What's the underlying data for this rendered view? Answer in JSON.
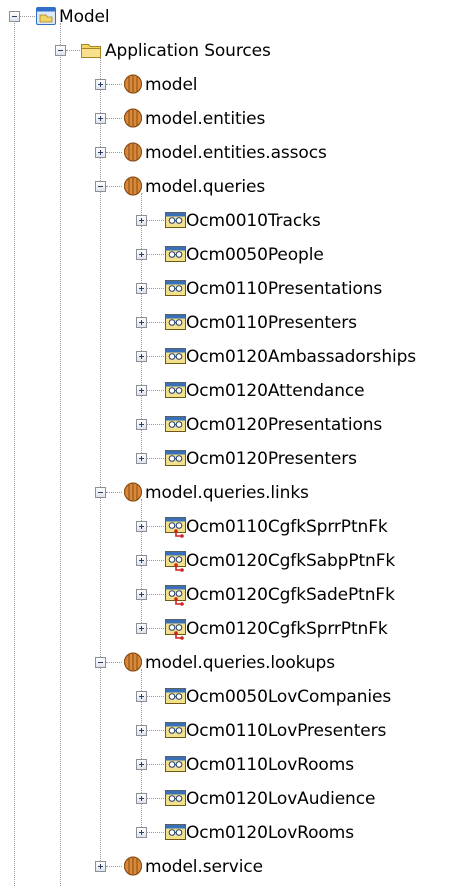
{
  "tree": {
    "root": {
      "label": "Model",
      "icon": "model-project-icon",
      "expanded": true
    },
    "nodes": [
      {
        "label": "Application Sources",
        "icon": "folder-icon",
        "level": 1,
        "expanded": true
      },
      {
        "label": "model",
        "icon": "package-icon",
        "level": 2,
        "expanded": false
      },
      {
        "label": "model.entities",
        "icon": "package-icon",
        "level": 2,
        "expanded": false
      },
      {
        "label": "model.entities.assocs",
        "icon": "package-icon",
        "level": 2,
        "expanded": false
      },
      {
        "label": "model.queries",
        "icon": "package-icon",
        "level": 2,
        "expanded": true
      },
      {
        "label": "Ocm0010Tracks",
        "icon": "view-object-icon",
        "level": 3,
        "expanded": false
      },
      {
        "label": "Ocm0050People",
        "icon": "view-object-icon",
        "level": 3,
        "expanded": false
      },
      {
        "label": "Ocm0110Presentations",
        "icon": "view-object-icon",
        "level": 3,
        "expanded": false
      },
      {
        "label": "Ocm0110Presenters",
        "icon": "view-object-icon",
        "level": 3,
        "expanded": false
      },
      {
        "label": "Ocm0120Ambassadorships",
        "icon": "view-object-icon",
        "level": 3,
        "expanded": false
      },
      {
        "label": "Ocm0120Attendance",
        "icon": "view-object-icon",
        "level": 3,
        "expanded": false
      },
      {
        "label": "Ocm0120Presentations",
        "icon": "view-object-icon",
        "level": 3,
        "expanded": false
      },
      {
        "label": "Ocm0120Presenters",
        "icon": "view-object-icon",
        "level": 3,
        "expanded": false
      },
      {
        "label": "model.queries.links",
        "icon": "package-icon",
        "level": 2,
        "expanded": true
      },
      {
        "label": "Ocm0110CgfkSprrPtnFk",
        "icon": "view-link-icon",
        "level": 3,
        "expanded": false
      },
      {
        "label": "Ocm0120CgfkSabpPtnFk",
        "icon": "view-link-icon",
        "level": 3,
        "expanded": false
      },
      {
        "label": "Ocm0120CgfkSadePtnFk",
        "icon": "view-link-icon",
        "level": 3,
        "expanded": false
      },
      {
        "label": "Ocm0120CgfkSprrPtnFk",
        "icon": "view-link-icon",
        "level": 3,
        "expanded": false
      },
      {
        "label": "model.queries.lookups",
        "icon": "package-icon",
        "level": 2,
        "expanded": true
      },
      {
        "label": "Ocm0050LovCompanies",
        "icon": "view-object-icon",
        "level": 3,
        "expanded": false
      },
      {
        "label": "Ocm0110LovPresenters",
        "icon": "view-object-icon",
        "level": 3,
        "expanded": false
      },
      {
        "label": "Ocm0110LovRooms",
        "icon": "view-object-icon",
        "level": 3,
        "expanded": false
      },
      {
        "label": "Ocm0120LovAudience",
        "icon": "view-object-icon",
        "level": 3,
        "expanded": false
      },
      {
        "label": "Ocm0120LovRooms",
        "icon": "view-object-icon",
        "level": 3,
        "expanded": false
      },
      {
        "label": "model.service",
        "icon": "package-icon",
        "level": 2,
        "expanded": false
      }
    ]
  },
  "colors": {
    "connector": "#9a9a9a",
    "folder": "#f2d468",
    "package": "#d9883a",
    "view_object": "#f3e08a",
    "view_link_badge": "#d02020",
    "project_blue": "#2f6fc9"
  }
}
